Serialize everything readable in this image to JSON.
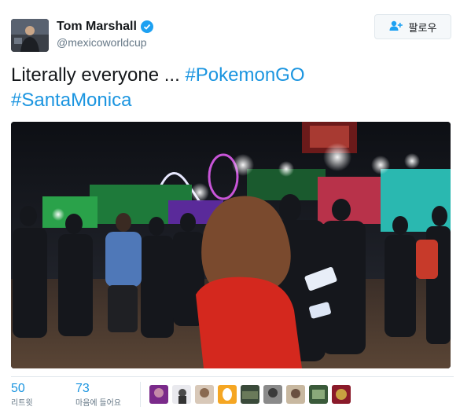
{
  "author": {
    "name": "Tom Marshall",
    "handle": "@mexicoworldcup",
    "verified": true
  },
  "follow_button": {
    "label": "팔로우",
    "icon": "person-add-icon"
  },
  "tweet": {
    "text_plain": "Literally everyone ... ",
    "hashtags": [
      "#PokemonGO",
      "#SantaMonica"
    ]
  },
  "stats": {
    "retweets": {
      "count": "50",
      "label": "리트윗"
    },
    "likes": {
      "count": "73",
      "label": "마음에 들어요"
    }
  },
  "likers": [
    "liker-1",
    "liker-2",
    "liker-3",
    "liker-4",
    "liker-5",
    "liker-6",
    "liker-7",
    "liker-8",
    "liker-9"
  ],
  "colors": {
    "link": "#1b95e0",
    "verified": "#1da1f2",
    "muted": "#657786",
    "border": "#e1e8ed"
  }
}
